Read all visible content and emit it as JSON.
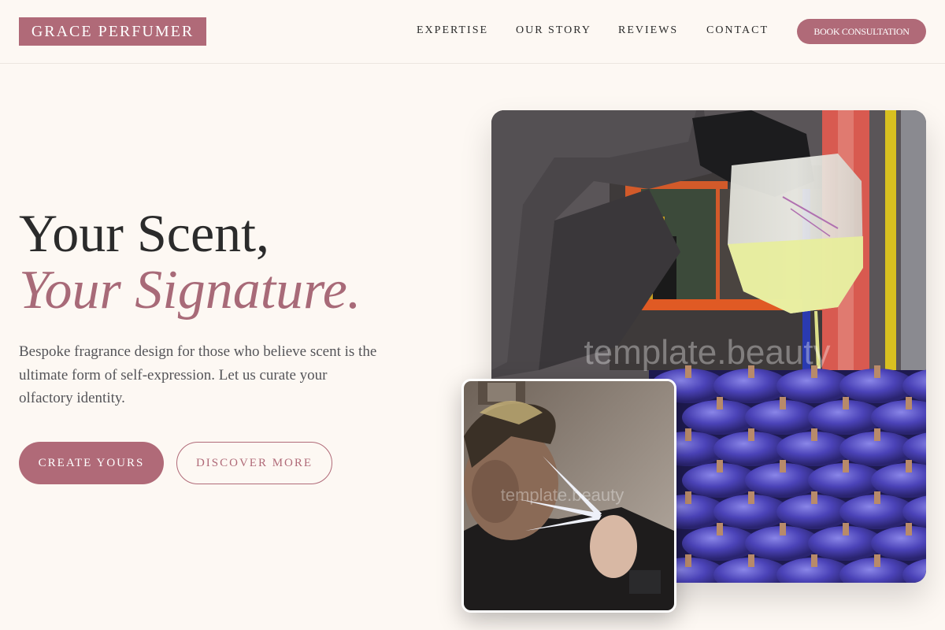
{
  "header": {
    "logo": "GRACE PERFUMER",
    "nav": [
      "EXPERTISE",
      "OUR STORY",
      "REVIEWS",
      "CONTACT"
    ],
    "cta": "BOOK CONSULTATION"
  },
  "hero": {
    "title_line1": "Your Scent,",
    "title_line2": "Your Signature.",
    "description": "Bespoke fragrance design for those who believe scent is the ultimate form of self-expression. Let us curate your olfactory identity.",
    "primary_button": "CREATE YOURS",
    "secondary_button": "DISCOVER MORE"
  },
  "images": {
    "main_watermark": "template.beauty",
    "small_watermark": "template.beauty"
  },
  "colors": {
    "accent": "#b06a78",
    "background": "#fdf8f3",
    "text": "#2b2b2b"
  }
}
